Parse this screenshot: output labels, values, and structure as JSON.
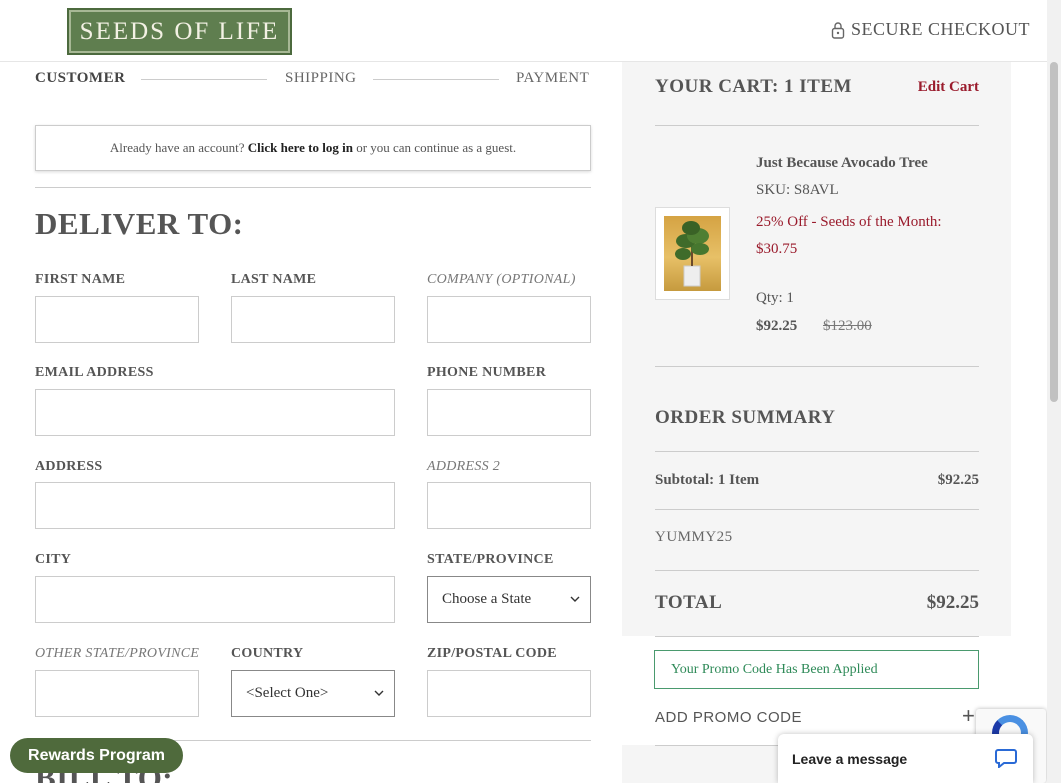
{
  "header": {
    "logo_text": "SEEDS OF LIFE",
    "secure_checkout": "SECURE CHECKOUT"
  },
  "steps": [
    "CUSTOMER",
    "SHIPPING",
    "PAYMENT"
  ],
  "login": {
    "prefix": "Already have an account?",
    "link": "Click here to log in",
    "suffix": "or you can continue as a guest."
  },
  "deliver": {
    "title": "DELIVER TO:",
    "fields": {
      "first_name": "FIRST NAME",
      "last_name": "LAST NAME",
      "company": "COMPANY (OPTIONAL)",
      "email": "EMAIL ADDRESS",
      "phone": "PHONE NUMBER",
      "address": "ADDRESS",
      "address2": "ADDRESS 2",
      "city": "CITY",
      "state": "STATE/PROVINCE",
      "other_state": "OTHER STATE/PROVINCE",
      "country": "COUNTRY",
      "zip": "ZIP/POSTAL CODE"
    },
    "state_selected": "Choose a State",
    "country_selected": "<Select One>"
  },
  "bill": {
    "title": "BILL TO:"
  },
  "cart": {
    "title": "YOUR CART: 1 ITEM",
    "edit": "Edit Cart",
    "item": {
      "name": "Just Because Avocado Tree",
      "sku": "SKU: S8AVL",
      "promo": "25% Off - Seeds of the Month: $30.75",
      "qty": "Qty: 1",
      "price": "$92.25",
      "old_price": "$123.00"
    }
  },
  "summary": {
    "title": "ORDER SUMMARY",
    "subtotal_label": "Subtotal: 1 Item",
    "subtotal_value": "$92.25",
    "promo_code": "YUMMY25",
    "total_label": "TOTAL",
    "total_value": "$92.25",
    "applied_msg": "Your Promo Code Has Been Applied",
    "add_promo": "ADD PROMO CODE",
    "add_symbol": "+"
  },
  "widgets": {
    "rewards": "Rewards Program",
    "chat": "Leave a message"
  },
  "colors": {
    "brand_green": "#5f7e4f",
    "accent_red": "#9a1b2c",
    "success_green": "#2e8a58"
  }
}
